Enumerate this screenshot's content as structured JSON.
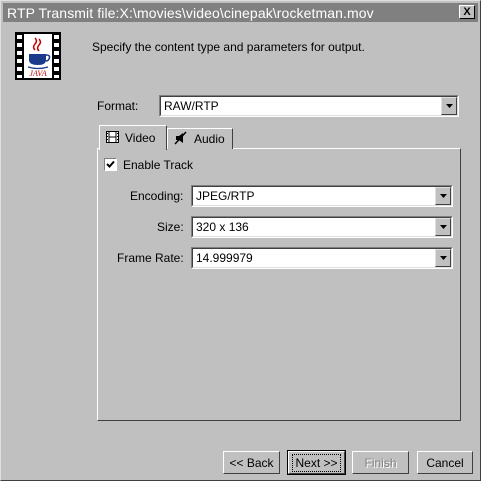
{
  "window": {
    "title": "RTP Transmit file:X:\\movies\\video\\cinepak\\rocketman.mov",
    "close_label": "X"
  },
  "logo": {
    "text": "JAVA",
    "icon": "java-logo-icon"
  },
  "instruction": "Specify the content type and parameters for output.",
  "format": {
    "label": "Format:",
    "value": "RAW/RTP"
  },
  "tabs": [
    {
      "label": "Video",
      "icon": "film-icon",
      "selected": true
    },
    {
      "label": "Audio",
      "icon": "speaker-muted-icon",
      "selected": false
    }
  ],
  "video": {
    "enable_track_label": "Enable Track",
    "enable_track_checked": true,
    "encoding": {
      "label": "Encoding:",
      "value": "JPEG/RTP"
    },
    "size": {
      "label": "Size:",
      "value": "320 x 136"
    },
    "frame_rate": {
      "label": "Frame Rate:",
      "value": "14.999979"
    }
  },
  "buttons": {
    "back": "<< Back",
    "next": "Next >>",
    "finish": "Finish",
    "cancel": "Cancel"
  }
}
